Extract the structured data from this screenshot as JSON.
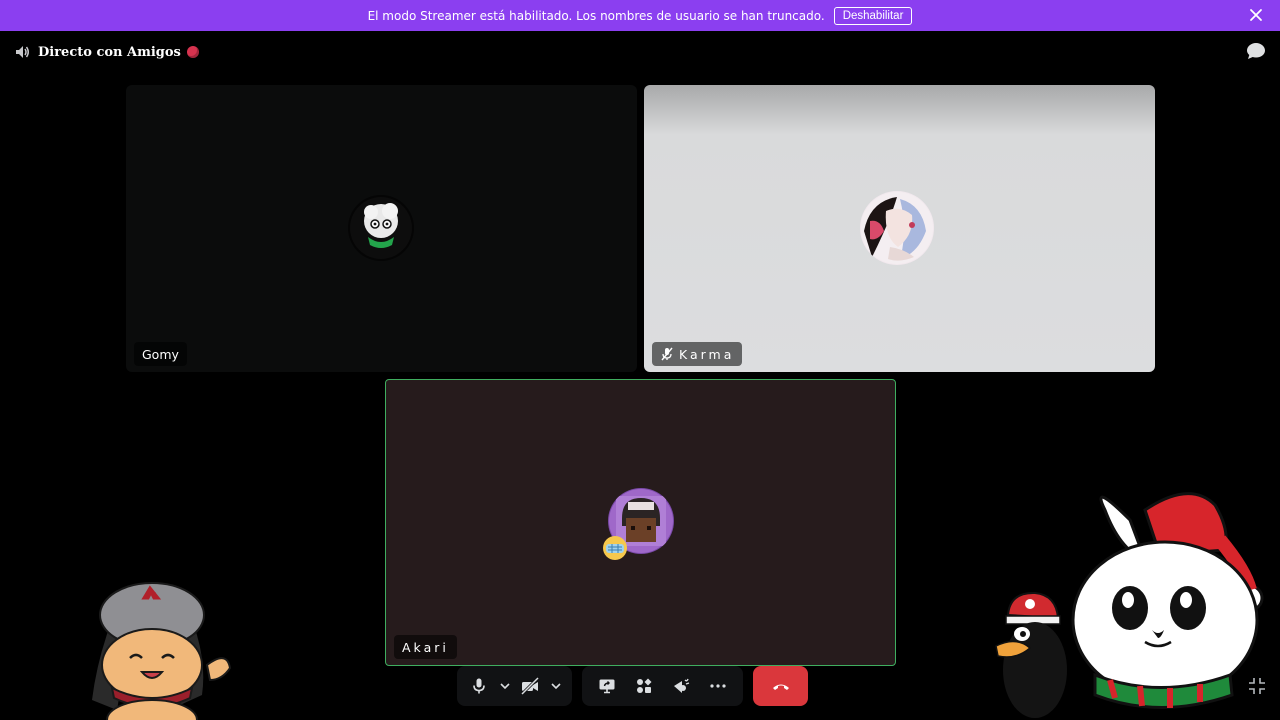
{
  "banner": {
    "message": "El modo Streamer está habilitado. Los nombres de usuario se han truncado.",
    "disable_label": "Deshabilitar"
  },
  "channel": {
    "title": "Directo con Amigos",
    "icon": "speaker-icon"
  },
  "participants": [
    {
      "name": "Gomy",
      "muted": false,
      "speaking": false
    },
    {
      "name": "Karma",
      "muted": true,
      "speaking": false
    },
    {
      "name": "Akari",
      "muted": false,
      "speaking": true
    }
  ],
  "controls": {
    "icons": [
      "microphone-icon",
      "chevron-down-icon",
      "camera-off-icon",
      "chevron-down-icon",
      "screen-share-icon",
      "activities-icon",
      "soundboard-icon",
      "more-icon",
      "hang-up-icon"
    ]
  },
  "colors": {
    "banner": "#8b3ff0",
    "speaking_border": "#3fae5f",
    "hangup": "#da373c",
    "live_dot": "#d7334f"
  }
}
